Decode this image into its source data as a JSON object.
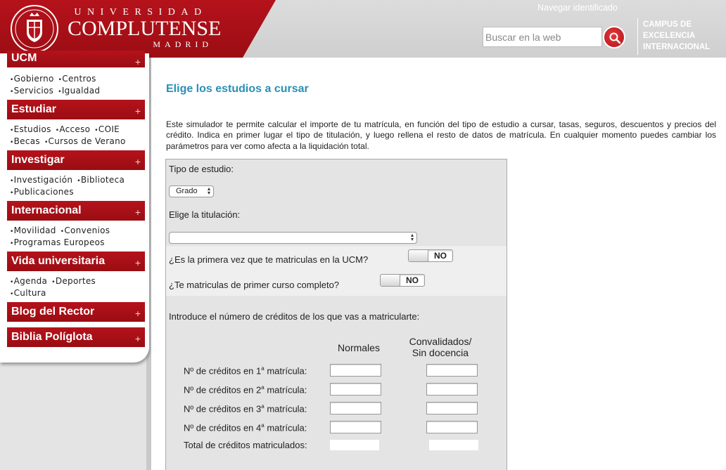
{
  "header": {
    "brand_line1": "UNIVERSIDAD",
    "brand_line2": "COMPLUTENSE",
    "brand_line3": "MADRID",
    "nav_link": "Navegar identificado",
    "search_placeholder": "Buscar en la web",
    "campus": [
      "CAMPUS DE",
      "EXCELENCIA",
      "INTERNACIONAL"
    ]
  },
  "sidebar": {
    "sections": [
      {
        "title": "UCM",
        "links": [
          [
            "Gobierno",
            "Centros"
          ],
          [
            "Servicios",
            "Igualdad"
          ]
        ]
      },
      {
        "title": "Estudiar",
        "links": [
          [
            "Estudios",
            "Acceso",
            "COIE"
          ],
          [
            "Becas",
            "Cursos de Verano"
          ]
        ]
      },
      {
        "title": "Investigar",
        "links": [
          [
            "Investigación",
            "Biblioteca"
          ],
          [
            "Publicaciones"
          ]
        ]
      },
      {
        "title": "Internacional",
        "links": [
          [
            "Movilidad",
            "Convenios"
          ],
          [
            "Programas Europeos"
          ]
        ]
      },
      {
        "title": "Vida universitaria",
        "links": [
          [
            "Agenda",
            "Deportes"
          ],
          [
            "Cultura"
          ]
        ]
      },
      {
        "title": "Blog del Rector",
        "links": []
      },
      {
        "title": "Biblia Políglota",
        "links": []
      }
    ],
    "plus": "+"
  },
  "main": {
    "title": "Elige los estudios a cursar",
    "intro": "Este simulador te permite calcular el importe de tu matrícula, en función del tipo de estudio a cursar, tasas, seguros, descuentos y precios del crédito. Indica en primer lugar el tipo de titulación, y luego rellena el resto de datos de matrícula. En cualquier momento puedes cambiar los parámetros para ver como afecta a la liquidación total.",
    "form": {
      "tipo_label": "Tipo de estudio:",
      "tipo_value": "Grado",
      "titulacion_label": "Elige la titulación:",
      "titulacion_value": "",
      "q_primera_vez": "¿Es la primera vez que te matriculas en la UCM?",
      "q_primer_curso": "¿Te matriculas de primer curso completo?",
      "toggle_value": "NO",
      "creditos_intro": "Introduce el número de créditos de los que vas a matricularte:",
      "col_normales": "Normales",
      "col_convalidados_1": "Convalidados/",
      "col_convalidados_2": "Sin docencia",
      "rows": [
        {
          "prefix": "Nº de créditos en 1",
          "sup": "a",
          "suffix": " matrícula:"
        },
        {
          "prefix": "Nº de créditos en 2",
          "sup": "a",
          "suffix": " matrícula:"
        },
        {
          "prefix": "Nº de créditos en 3",
          "sup": "a",
          "suffix": " matrícula:"
        },
        {
          "prefix": "Nº de créditos en 4",
          "sup": "a",
          "suffix": " matrícula:"
        }
      ],
      "total_label": "Total de créditos matriculados:"
    }
  },
  "colors": {
    "brand_red": "#b5121b",
    "title_blue": "#2a8fb5"
  }
}
